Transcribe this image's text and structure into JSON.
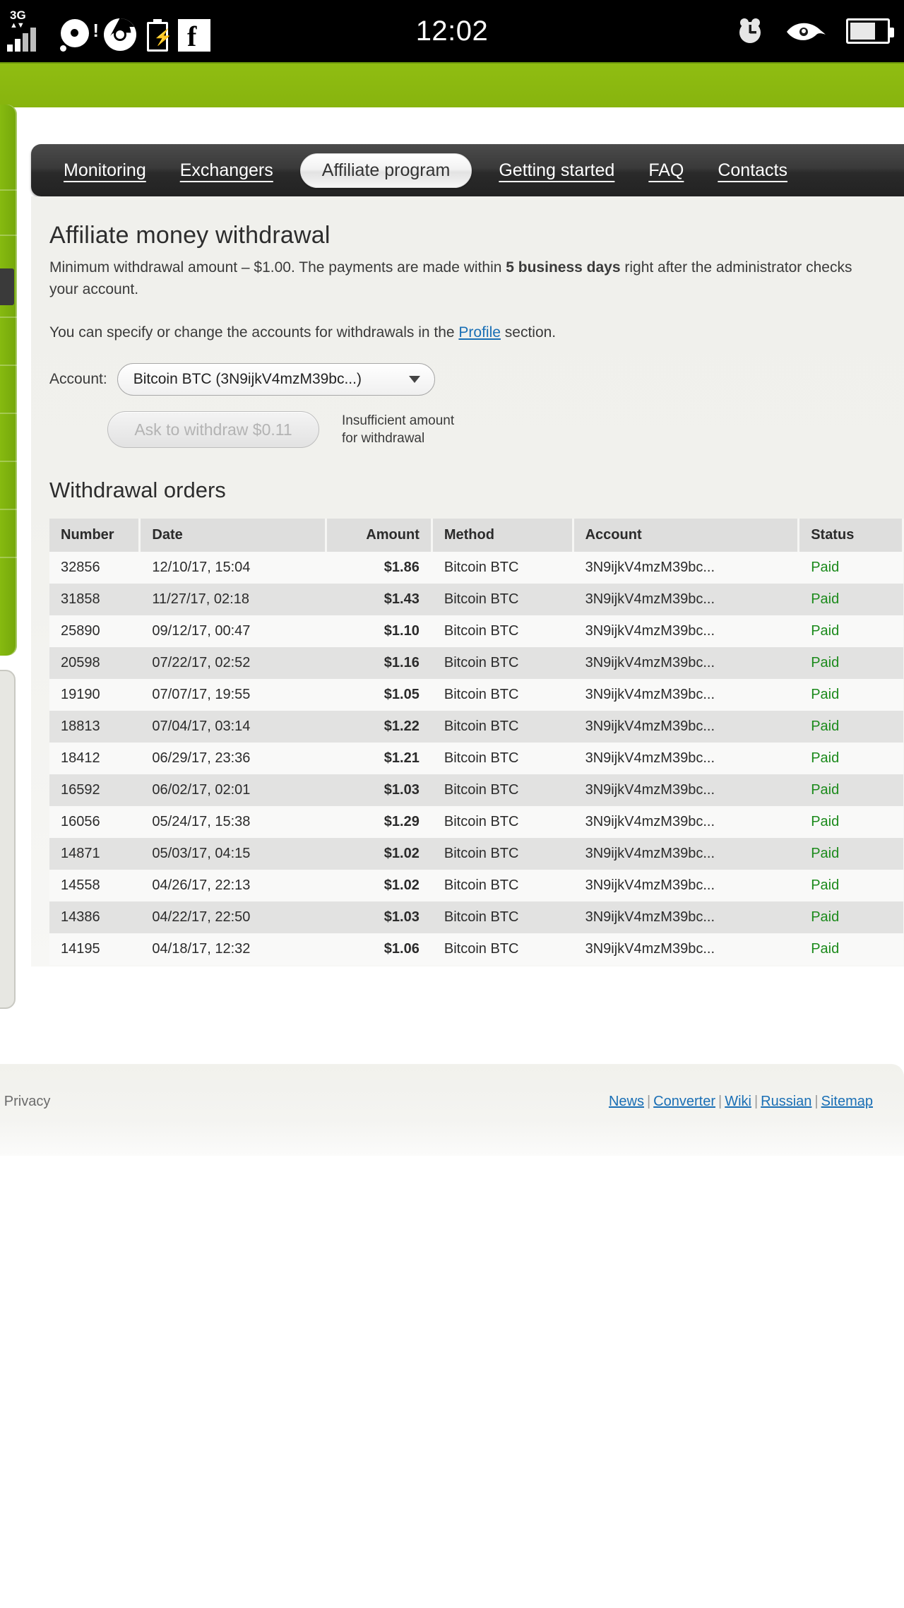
{
  "statusbar": {
    "time": "12:02",
    "network_label": "3G",
    "left_icons": [
      "signal-3g-icon",
      "disc-alert-icon",
      "chrome-icon",
      "battery-charging-icon",
      "facebook-icon"
    ],
    "right_icons": [
      "alarm-clock-icon",
      "eye-icon",
      "battery-icon"
    ]
  },
  "nav": {
    "tabs": [
      {
        "label": "Monitoring",
        "active": false
      },
      {
        "label": "Exchangers",
        "active": false
      },
      {
        "label": "Affiliate program",
        "active": true
      },
      {
        "label": "Getting started",
        "active": false
      },
      {
        "label": "FAQ",
        "active": false
      },
      {
        "label": "Contacts",
        "active": false
      }
    ]
  },
  "main": {
    "title": "Affiliate money withdrawal",
    "lead_part1": "Minimum withdrawal amount – $1.00. The payments are made within ",
    "lead_bold": "5 business days",
    "lead_part2": " right after the administrator checks your account.",
    "lead2_part1": "You can specify or change the accounts for withdrawals in the ",
    "lead2_link": "Profile",
    "lead2_part2": " section.",
    "account_label": "Account:",
    "account_value": "Bitcoin BTC (3N9ijkV4mzM39bc...)",
    "withdraw_button": "Ask to withdraw $0.11",
    "withdraw_hint_line1": "Insufficient amount",
    "withdraw_hint_line2": "for withdrawal",
    "orders_title": "Withdrawal orders"
  },
  "table": {
    "columns": [
      "Number",
      "Date",
      "Amount",
      "Method",
      "Account",
      "Status"
    ],
    "rows": [
      {
        "number": "32856",
        "date": "12/10/17, 15:04",
        "amount": "$1.86",
        "method": "Bitcoin BTC",
        "account": "3N9ijkV4mzM39bc...",
        "status": "Paid"
      },
      {
        "number": "31858",
        "date": "11/27/17, 02:18",
        "amount": "$1.43",
        "method": "Bitcoin BTC",
        "account": "3N9ijkV4mzM39bc...",
        "status": "Paid"
      },
      {
        "number": "25890",
        "date": "09/12/17, 00:47",
        "amount": "$1.10",
        "method": "Bitcoin BTC",
        "account": "3N9ijkV4mzM39bc...",
        "status": "Paid"
      },
      {
        "number": "20598",
        "date": "07/22/17, 02:52",
        "amount": "$1.16",
        "method": "Bitcoin BTC",
        "account": "3N9ijkV4mzM39bc...",
        "status": "Paid"
      },
      {
        "number": "19190",
        "date": "07/07/17, 19:55",
        "amount": "$1.05",
        "method": "Bitcoin BTC",
        "account": "3N9ijkV4mzM39bc...",
        "status": "Paid"
      },
      {
        "number": "18813",
        "date": "07/04/17, 03:14",
        "amount": "$1.22",
        "method": "Bitcoin BTC",
        "account": "3N9ijkV4mzM39bc...",
        "status": "Paid"
      },
      {
        "number": "18412",
        "date": "06/29/17, 23:36",
        "amount": "$1.21",
        "method": "Bitcoin BTC",
        "account": "3N9ijkV4mzM39bc...",
        "status": "Paid"
      },
      {
        "number": "16592",
        "date": "06/02/17, 02:01",
        "amount": "$1.03",
        "method": "Bitcoin BTC",
        "account": "3N9ijkV4mzM39bc...",
        "status": "Paid"
      },
      {
        "number": "16056",
        "date": "05/24/17, 15:38",
        "amount": "$1.29",
        "method": "Bitcoin BTC",
        "account": "3N9ijkV4mzM39bc...",
        "status": "Paid"
      },
      {
        "number": "14871",
        "date": "05/03/17, 04:15",
        "amount": "$1.02",
        "method": "Bitcoin BTC",
        "account": "3N9ijkV4mzM39bc...",
        "status": "Paid"
      },
      {
        "number": "14558",
        "date": "04/26/17, 22:13",
        "amount": "$1.02",
        "method": "Bitcoin BTC",
        "account": "3N9ijkV4mzM39bc...",
        "status": "Paid"
      },
      {
        "number": "14386",
        "date": "04/22/17, 22:50",
        "amount": "$1.03",
        "method": "Bitcoin BTC",
        "account": "3N9ijkV4mzM39bc...",
        "status": "Paid"
      },
      {
        "number": "14195",
        "date": "04/18/17, 12:32",
        "amount": "$1.06",
        "method": "Bitcoin BTC",
        "account": "3N9ijkV4mzM39bc...",
        "status": "Paid"
      }
    ]
  },
  "footer": {
    "left_text": "rms & Privacy",
    "links": [
      "News",
      "Converter",
      "Wiki",
      "Russian",
      "Sitemap"
    ],
    "separator": "|"
  },
  "colors": {
    "brand_green": "#8cba10",
    "link_blue": "#1a6fb5",
    "status_paid_green": "#1b8a1b",
    "nav_dark": "#2a2a2a",
    "panel_bg": "#f1f1ed"
  }
}
